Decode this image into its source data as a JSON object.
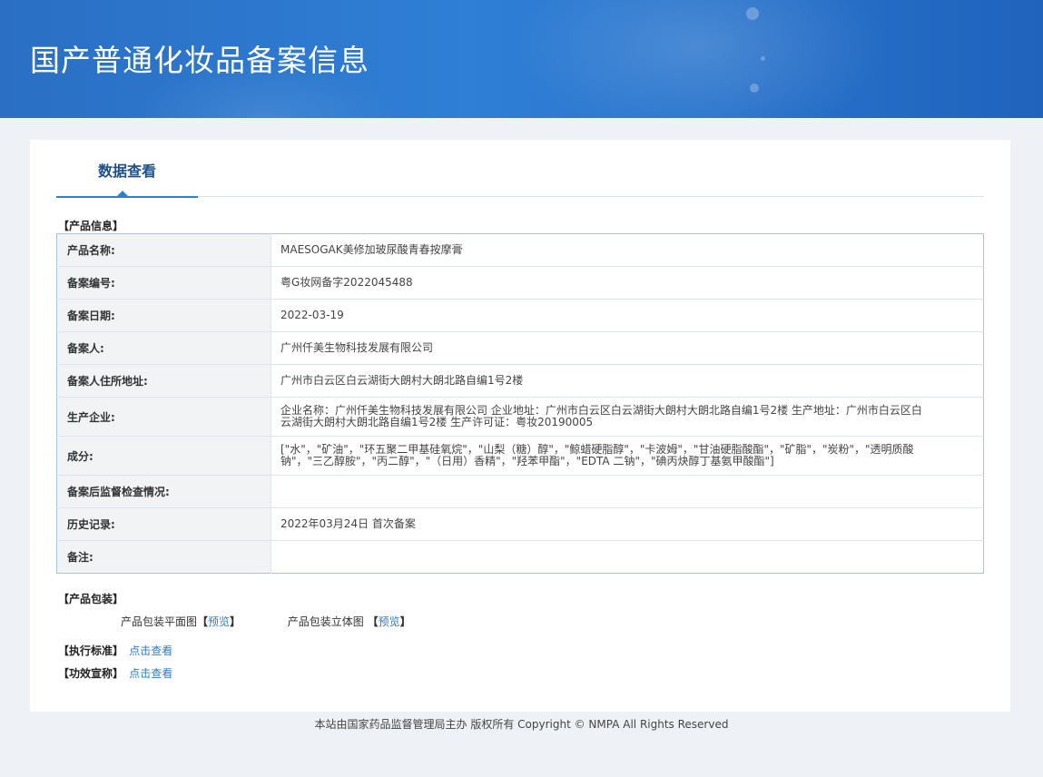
{
  "header": {
    "title": "国产普通化妆品备案信息"
  },
  "tab": {
    "label": "数据查看"
  },
  "product_info": {
    "section_title": "【产品信息】",
    "rows": [
      {
        "label": "产品名称:",
        "value": "MAESOGAK美修加玻尿酸青春按摩膏"
      },
      {
        "label": "备案编号:",
        "value": "粤G妆网备字2022045488"
      },
      {
        "label": "备案日期:",
        "value": "2022-03-19"
      },
      {
        "label": "备案人:",
        "value": "广州仟美生物科技发展有限公司"
      },
      {
        "label": "备案人住所地址:",
        "value": "广州市白云区白云湖街大朗村大朗北路自编1号2楼"
      },
      {
        "label": "生产企业:",
        "value": "企业名称：广州仟美生物科技发展有限公司 企业地址：广州市白云区白云湖街大朗村大朗北路自编1号2楼 生产地址：广州市白云区白云湖街大朗村大朗北路自编1号2楼 生产许可证：粤妆20190005"
      },
      {
        "label": "成分:",
        "value": "[\"水\"，\"矿油\"，\"环五聚二甲基硅氧烷\"，\"山梨（糖）醇\"，\"鲸蜡硬脂醇\"，\"卡波姆\"，\"甘油硬脂酸酯\"，\"矿脂\"，\"炭粉\"，\"透明质酸钠\"，\"三乙醇胺\"，\"丙二醇\"，\"（日用）香精\"，\"羟苯甲酯\"，\"EDTA 二钠\"，\"碘丙炔醇丁基氨甲酸酯\"]"
      },
      {
        "label": "备案后监督检查情况:",
        "value": ""
      },
      {
        "label": "历史记录:",
        "value": "2022年03月24日 首次备案"
      },
      {
        "label": "备注:",
        "value": ""
      }
    ]
  },
  "packaging": {
    "section_title": "【产品包装】",
    "flat_label": "产品包装平面图",
    "stereo_label": "产品包装立体图",
    "bracket_open": "【",
    "bracket_close": "】",
    "preview_link": "预览"
  },
  "standard": {
    "label": "【执行标准】",
    "link": "点击查看"
  },
  "efficacy": {
    "label": "【功效宣称】",
    "link": "点击查看"
  },
  "footer": {
    "text": "本站由国家药品监督管理局主办 版权所有 Copyright © NMPA All Rights Reserved"
  }
}
